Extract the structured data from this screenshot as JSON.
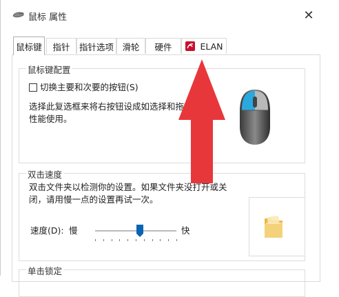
{
  "window": {
    "title": "鼠标 属性",
    "close_glyph": "✕"
  },
  "tabs": [
    {
      "label": "鼠标键",
      "active": true
    },
    {
      "label": "指针",
      "active": false
    },
    {
      "label": "指针选项",
      "active": false
    },
    {
      "label": "滑轮",
      "active": false
    },
    {
      "label": "硬件",
      "active": false
    },
    {
      "label": "ELAN",
      "active": false
    }
  ],
  "button_config": {
    "group_title": "鼠标键配置",
    "checkbox_label": "切换主要和次要的按钮(S)",
    "checked": false,
    "description_line1": "选择此复选框来将右按钮设成如选择和拖放",
    "description_line2": "性能使用。"
  },
  "double_click": {
    "group_title": "双击速度",
    "description_line1": "双击文件夹以检测你的设置。如果文件夹没打开或关",
    "description_line2": "闭，请用慢一点的设置再试一次。",
    "speed_label": "速度(D):",
    "slow_label": "慢",
    "fast_label": "快",
    "speed_level": 0.55
  },
  "click_lock": {
    "group_title": "单击锁定"
  },
  "colors": {
    "arrow": "#e8373b",
    "mouse_highlight": "#2aa9e0",
    "slider_thumb": "#0a64b4",
    "folder": "#f3d27a"
  },
  "icons": {
    "app": "mouse-icon",
    "elan": "elan-touchpad-icon",
    "close": "close-icon",
    "folder": "folder-icon",
    "annotation": "red-up-arrow"
  }
}
